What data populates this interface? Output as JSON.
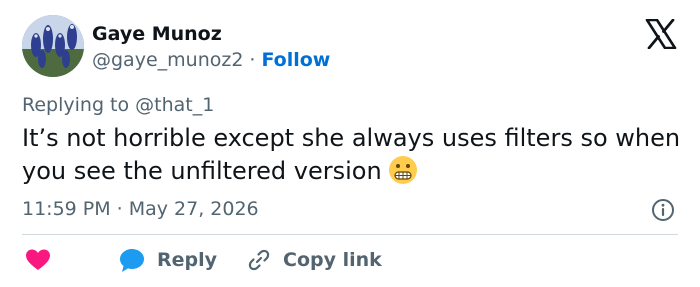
{
  "author": {
    "name": "Gaye Munoz",
    "handle": "@gaye_munoz2",
    "separator": "·",
    "follow_label": "Follow"
  },
  "reply_context": {
    "prefix": "Replying to",
    "mention": "@that_1"
  },
  "tweet": {
    "text": "It’s not horrible except she always uses filters so when you see the unfiltered version",
    "emoji": "grimacing-face"
  },
  "meta": {
    "time": "11:59 PM",
    "separator": "·",
    "date": "May 27, 2026"
  },
  "actions": {
    "like_icon": "heart-icon",
    "reply_label": "Reply",
    "copy_link_label": "Copy link"
  },
  "colors": {
    "accent": "#006fd6",
    "heart": "#f91880",
    "reply_bubble": "#1d9bf0",
    "muted_text": "#536471",
    "divider": "#cfd9de"
  },
  "icons": {
    "brand": "x-logo-icon",
    "info": "info-icon",
    "link": "link-icon"
  }
}
